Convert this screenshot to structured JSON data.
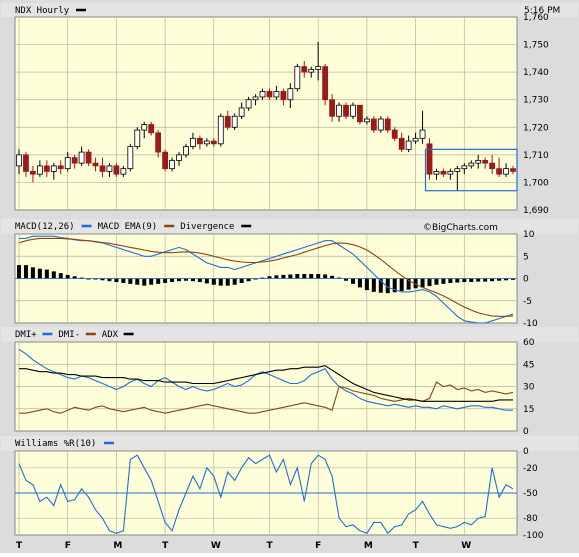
{
  "chart_data": [
    {
      "type": "candlestick",
      "title": "NDX Hourly",
      "timestamp": "5:16 PM",
      "ylim": [
        1690,
        1760
      ],
      "yticks": [
        "1,690",
        "1,700",
        "1,710",
        "1,720",
        "1,730",
        "1,740",
        "1,750",
        "1,760"
      ],
      "yticks_values": [
        1690,
        1700,
        1710,
        1720,
        1730,
        1740,
        1750,
        1760
      ],
      "candles": [
        {
          "o": 1706,
          "h": 1712,
          "l": 1703,
          "c": 1710
        },
        {
          "o": 1710,
          "h": 1711,
          "l": 1702,
          "c": 1704
        },
        {
          "o": 1704,
          "h": 1706,
          "l": 1700,
          "c": 1703
        },
        {
          "o": 1703,
          "h": 1708,
          "l": 1702,
          "c": 1706
        },
        {
          "o": 1706,
          "h": 1708,
          "l": 1702,
          "c": 1704
        },
        {
          "o": 1704,
          "h": 1707,
          "l": 1701,
          "c": 1706
        },
        {
          "o": 1706,
          "h": 1708,
          "l": 1703,
          "c": 1705
        },
        {
          "o": 1705,
          "h": 1711,
          "l": 1704,
          "c": 1709
        },
        {
          "o": 1709,
          "h": 1710,
          "l": 1705,
          "c": 1707
        },
        {
          "o": 1707,
          "h": 1713,
          "l": 1706,
          "c": 1711
        },
        {
          "o": 1711,
          "h": 1712,
          "l": 1706,
          "c": 1707
        },
        {
          "o": 1707,
          "h": 1709,
          "l": 1704,
          "c": 1706
        },
        {
          "o": 1706,
          "h": 1709,
          "l": 1702,
          "c": 1704
        },
        {
          "o": 1704,
          "h": 1707,
          "l": 1702,
          "c": 1706
        },
        {
          "o": 1706,
          "h": 1707,
          "l": 1702,
          "c": 1703
        },
        {
          "o": 1703,
          "h": 1706,
          "l": 1702,
          "c": 1705
        },
        {
          "o": 1705,
          "h": 1714,
          "l": 1704,
          "c": 1713
        },
        {
          "o": 1713,
          "h": 1720,
          "l": 1712,
          "c": 1719
        },
        {
          "o": 1719,
          "h": 1722,
          "l": 1716,
          "c": 1721
        },
        {
          "o": 1721,
          "h": 1722,
          "l": 1717,
          "c": 1718
        },
        {
          "o": 1718,
          "h": 1719,
          "l": 1709,
          "c": 1711
        },
        {
          "o": 1711,
          "h": 1712,
          "l": 1704,
          "c": 1705
        },
        {
          "o": 1705,
          "h": 1709,
          "l": 1704,
          "c": 1708
        },
        {
          "o": 1708,
          "h": 1711,
          "l": 1706,
          "c": 1710
        },
        {
          "o": 1710,
          "h": 1714,
          "l": 1709,
          "c": 1713
        },
        {
          "o": 1713,
          "h": 1718,
          "l": 1712,
          "c": 1716
        },
        {
          "o": 1716,
          "h": 1717,
          "l": 1712,
          "c": 1714
        },
        {
          "o": 1714,
          "h": 1716,
          "l": 1713,
          "c": 1715
        },
        {
          "o": 1715,
          "h": 1716,
          "l": 1713,
          "c": 1714
        },
        {
          "o": 1714,
          "h": 1725,
          "l": 1713,
          "c": 1724
        },
        {
          "o": 1724,
          "h": 1726,
          "l": 1719,
          "c": 1720
        },
        {
          "o": 1720,
          "h": 1725,
          "l": 1719,
          "c": 1724
        },
        {
          "o": 1724,
          "h": 1729,
          "l": 1723,
          "c": 1727
        },
        {
          "o": 1727,
          "h": 1731,
          "l": 1726,
          "c": 1730
        },
        {
          "o": 1730,
          "h": 1732,
          "l": 1728,
          "c": 1731
        },
        {
          "o": 1731,
          "h": 1734,
          "l": 1730,
          "c": 1733
        },
        {
          "o": 1733,
          "h": 1734,
          "l": 1730,
          "c": 1731
        },
        {
          "o": 1731,
          "h": 1735,
          "l": 1730,
          "c": 1733
        },
        {
          "o": 1733,
          "h": 1734,
          "l": 1728,
          "c": 1730
        },
        {
          "o": 1730,
          "h": 1736,
          "l": 1727,
          "c": 1734
        },
        {
          "o": 1734,
          "h": 1743,
          "l": 1733,
          "c": 1742
        },
        {
          "o": 1742,
          "h": 1744,
          "l": 1738,
          "c": 1740
        },
        {
          "o": 1740,
          "h": 1742,
          "l": 1738,
          "c": 1741
        },
        {
          "o": 1741,
          "h": 1751,
          "l": 1737,
          "c": 1742
        },
        {
          "o": 1742,
          "h": 1743,
          "l": 1728,
          "c": 1730
        },
        {
          "o": 1730,
          "h": 1732,
          "l": 1722,
          "c": 1724
        },
        {
          "o": 1724,
          "h": 1729,
          "l": 1722,
          "c": 1728
        },
        {
          "o": 1728,
          "h": 1729,
          "l": 1723,
          "c": 1724
        },
        {
          "o": 1724,
          "h": 1729,
          "l": 1723,
          "c": 1728
        },
        {
          "o": 1728,
          "h": 1728,
          "l": 1721,
          "c": 1722
        },
        {
          "o": 1722,
          "h": 1724,
          "l": 1721,
          "c": 1723
        },
        {
          "o": 1723,
          "h": 1724,
          "l": 1718,
          "c": 1719
        },
        {
          "o": 1719,
          "h": 1724,
          "l": 1718,
          "c": 1723
        },
        {
          "o": 1723,
          "h": 1724,
          "l": 1718,
          "c": 1719
        },
        {
          "o": 1719,
          "h": 1720,
          "l": 1715,
          "c": 1716
        },
        {
          "o": 1716,
          "h": 1718,
          "l": 1711,
          "c": 1712
        },
        {
          "o": 1712,
          "h": 1717,
          "l": 1711,
          "c": 1715
        },
        {
          "o": 1715,
          "h": 1718,
          "l": 1714,
          "c": 1716
        },
        {
          "o": 1716,
          "h": 1726,
          "l": 1714,
          "c": 1719
        },
        {
          "o": 1714,
          "h": 1716,
          "l": 1701,
          "c": 1703
        },
        {
          "o": 1703,
          "h": 1705,
          "l": 1701,
          "c": 1704
        },
        {
          "o": 1704,
          "h": 1705,
          "l": 1702,
          "c": 1703
        },
        {
          "o": 1703,
          "h": 1705,
          "l": 1701,
          "c": 1704
        },
        {
          "o": 1704,
          "h": 1706,
          "l": 1697,
          "c": 1705
        },
        {
          "o": 1705,
          "h": 1707,
          "l": 1703,
          "c": 1706
        },
        {
          "o": 1706,
          "h": 1708,
          "l": 1705,
          "c": 1707
        },
        {
          "o": 1707,
          "h": 1710,
          "l": 1705,
          "c": 1708
        },
        {
          "o": 1708,
          "h": 1709,
          "l": 1705,
          "c": 1707
        },
        {
          "o": 1707,
          "h": 1710,
          "l": 1703,
          "c": 1705
        },
        {
          "o": 1705,
          "h": 1709,
          "l": 1702,
          "c": 1703
        },
        {
          "o": 1703,
          "h": 1707,
          "l": 1702,
          "c": 1705
        },
        {
          "o": 1705,
          "h": 1706,
          "l": 1703,
          "c": 1704
        }
      ],
      "box": {
        "x_from_index": 59,
        "x_to_index": 71,
        "y_low": 1697,
        "y_high": 1712
      },
      "xticks": [
        "T",
        "F",
        "M",
        "T",
        "W",
        "T",
        "F",
        "M",
        "T",
        "W"
      ],
      "xticks_index": [
        0,
        7,
        14,
        21,
        28,
        36,
        43,
        50,
        57,
        64
      ],
      "grid": true
    },
    {
      "type": "line",
      "title": "MACD(12,26)",
      "legend": [
        "MACD(12,26)",
        "MACD EMA(9)",
        "Divergence"
      ],
      "watermark": "©BigCharts.com",
      "ylim": [
        -10,
        10
      ],
      "yticks": [
        "10",
        "5",
        "0",
        "-5",
        "-10"
      ],
      "yticks_values": [
        10,
        5,
        0,
        -5,
        -10
      ],
      "series": [
        {
          "name": "MACD(12,26)",
          "color": "#1f6fd6",
          "values": [
            9,
            9,
            9.5,
            9.5,
            9.5,
            9.5,
            9.2,
            9,
            8.7,
            8.5,
            8.5,
            8.2,
            8,
            7.5,
            7,
            6.5,
            6,
            5.5,
            5,
            5,
            5.5,
            6,
            6.5,
            7,
            6.5,
            5.5,
            4.5,
            3.5,
            3,
            2.5,
            2.5,
            2,
            2.5,
            3,
            3.5,
            4,
            4.5,
            5,
            5.5,
            6,
            6.5,
            7,
            7.5,
            8,
            8.5,
            8.5,
            7.5,
            6.5,
            5.5,
            4,
            2.5,
            1,
            -0.5,
            -2,
            -2.5,
            -3,
            -3,
            -2.8,
            -2.5,
            -3,
            -4,
            -5.5,
            -7,
            -8.5,
            -9.5,
            -9.8,
            -10,
            -10,
            -9.5,
            -9,
            -8.5,
            -8
          ]
        },
        {
          "name": "MACD EMA(9)",
          "color": "#8b4513",
          "values": [
            8,
            8.5,
            8.8,
            9,
            9,
            9,
            9,
            8.9,
            8.8,
            8.6,
            8.5,
            8.3,
            8.1,
            7.9,
            7.6,
            7.3,
            7,
            6.7,
            6.4,
            6.1,
            5.9,
            5.8,
            5.8,
            5.9,
            6,
            5.9,
            5.7,
            5.4,
            5,
            4.6,
            4.2,
            3.9,
            3.7,
            3.6,
            3.6,
            3.7,
            3.9,
            4.2,
            4.6,
            5,
            5.4,
            5.9,
            6.4,
            6.9,
            7.4,
            7.8,
            8,
            7.9,
            7.6,
            7.1,
            6.4,
            5.4,
            4.3,
            3,
            1.8,
            0.6,
            -0.4,
            -1.3,
            -2,
            -2.6,
            -3.2,
            -3.9,
            -4.7,
            -5.6,
            -6.4,
            -7.1,
            -7.7,
            -8.1,
            -8.4,
            -8.5,
            -8.5,
            -8.4
          ]
        },
        {
          "name": "Divergence",
          "color": "#000000",
          "type": "bar",
          "values": [
            3,
            3,
            2.5,
            2.2,
            2,
            1.6,
            1.2,
            0.8,
            0.5,
            0.2,
            0,
            -0.2,
            -0.4,
            -0.6,
            -0.8,
            -1,
            -1.2,
            -1.4,
            -1.6,
            -1.4,
            -1.2,
            -1,
            -0.8,
            -0.6,
            -0.5,
            -0.6,
            -0.8,
            -1.1,
            -1.4,
            -1.6,
            -1.6,
            -1.4,
            -1,
            -0.6,
            -0.2,
            0.2,
            0.5,
            0.7,
            0.8,
            0.9,
            1,
            1,
            1,
            1,
            0.9,
            0.6,
            0.2,
            -0.5,
            -1.2,
            -2,
            -2.6,
            -3,
            -3.2,
            -3.3,
            -3.1,
            -2.8,
            -2.5,
            -2.2,
            -2,
            -1.7,
            -1.4,
            -1.2,
            -1,
            -0.9,
            -0.8,
            -0.8,
            -0.7,
            -0.7,
            -0.6,
            -0.5,
            -0.4,
            -0.3
          ]
        }
      ],
      "grid": true
    },
    {
      "type": "line",
      "title": "DMI+",
      "legend": [
        "DMI+",
        "DMI-",
        "ADX"
      ],
      "ylim": [
        0,
        60
      ],
      "yticks": [
        "60",
        "45",
        "30",
        "15",
        "0"
      ],
      "yticks_values": [
        60,
        45,
        30,
        15,
        0
      ],
      "series": [
        {
          "name": "DMI+",
          "color": "#1f6fd6",
          "values": [
            55,
            52,
            48,
            45,
            42,
            40,
            38,
            36,
            35,
            37,
            36,
            34,
            32,
            30,
            28,
            30,
            33,
            35,
            32,
            30,
            34,
            36,
            33,
            30,
            28,
            30,
            28,
            27,
            28,
            30,
            32,
            30,
            31,
            34,
            38,
            40,
            38,
            36,
            34,
            32,
            32,
            34,
            38,
            40,
            42,
            35,
            30,
            27,
            25,
            22,
            20,
            19,
            18,
            17,
            18,
            17,
            16,
            17,
            16,
            16,
            15,
            17,
            16,
            15,
            16,
            17,
            17,
            16,
            16,
            15,
            14,
            14
          ]
        },
        {
          "name": "DMI-",
          "color": "#8b4513",
          "values": [
            12,
            12,
            13,
            14,
            15,
            13,
            12,
            14,
            16,
            15,
            14,
            16,
            17,
            15,
            14,
            13,
            14,
            15,
            16,
            14,
            13,
            12,
            13,
            14,
            15,
            16,
            17,
            18,
            17,
            16,
            15,
            14,
            13,
            12,
            12,
            13,
            14,
            15,
            16,
            17,
            18,
            19,
            18,
            17,
            16,
            14,
            30,
            29,
            27,
            26,
            25,
            24,
            22,
            21,
            20,
            21,
            22,
            21,
            20,
            22,
            33,
            30,
            31,
            28,
            29,
            27,
            28,
            26,
            27,
            26,
            25,
            26
          ]
        },
        {
          "name": "ADX",
          "color": "#000000",
          "values": [
            42,
            42,
            41,
            40,
            40,
            39,
            39,
            38,
            38,
            37,
            37,
            37,
            36,
            36,
            36,
            36,
            35,
            35,
            34,
            34,
            34,
            33,
            33,
            33,
            33,
            32,
            32,
            32,
            32,
            33,
            34,
            35,
            36,
            37,
            38,
            39,
            40,
            41,
            41,
            42,
            42,
            43,
            43,
            43,
            44,
            41,
            38,
            35,
            32,
            30,
            28,
            26,
            25,
            24,
            23,
            22,
            21,
            21,
            20,
            20,
            20,
            20,
            20,
            20,
            20,
            20,
            20,
            20,
            20,
            21,
            21,
            21
          ]
        }
      ],
      "grid": true
    },
    {
      "type": "line",
      "title": "Williams %R(10)",
      "legend": [
        "Williams %R(10)"
      ],
      "ylim": [
        -100,
        0
      ],
      "yticks": [
        "0",
        "-20",
        "-50",
        "-80",
        "-100"
      ],
      "yticks_values": [
        0,
        -20,
        -50,
        -80,
        -100
      ],
      "series": [
        {
          "name": "Williams %R(10)",
          "color": "#1f6fd6",
          "values": [
            -15,
            -35,
            -40,
            -60,
            -55,
            -65,
            -40,
            -60,
            -58,
            -45,
            -55,
            -70,
            -80,
            -95,
            -98,
            -95,
            -10,
            -5,
            -20,
            -35,
            -60,
            -85,
            -95,
            -70,
            -50,
            -30,
            -45,
            -20,
            -30,
            -55,
            -25,
            -35,
            -20,
            -8,
            -15,
            -10,
            -5,
            -25,
            -10,
            -40,
            -20,
            -60,
            -15,
            -5,
            -10,
            -30,
            -80,
            -90,
            -88,
            -95,
            -98,
            -85,
            -85,
            -98,
            -90,
            -88,
            -75,
            -70,
            -60,
            -75,
            -88,
            -90,
            -92,
            -90,
            -85,
            -88,
            -80,
            -78,
            -20,
            -55,
            -40,
            -45
          ]
        }
      ],
      "grid": true
    }
  ]
}
